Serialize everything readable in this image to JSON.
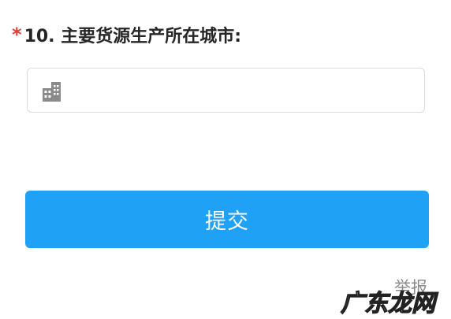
{
  "question": {
    "required_mark": "*",
    "title": "10. 主要货源生产所在城市:"
  },
  "city_field": {
    "icon": "building-icon",
    "value": "",
    "placeholder": ""
  },
  "submit": {
    "label": "提交",
    "color": "#1fa1f5"
  },
  "footer": {
    "report_label": "举报"
  },
  "watermark": {
    "text": "广东龙网"
  }
}
